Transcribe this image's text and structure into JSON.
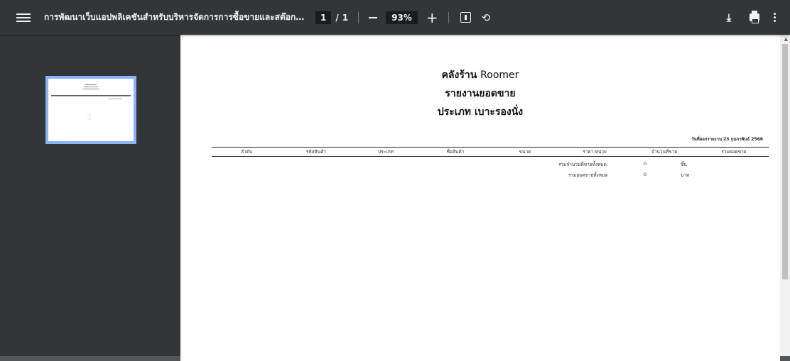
{
  "toolbar": {
    "doc_title": "การพัฒนาเว็บแอปพลิเคชันสำหรับบริหารจัดการการซื้อขายและสต๊อกสินค้า ร้า...",
    "page_current": "1",
    "page_separator": "/",
    "page_total": "1",
    "zoom": "93%",
    "zoom_in_symbol": "+",
    "rotate_symbol": "⟲",
    "download_symbol": "⤓",
    "icons": [
      "menu-icon",
      "fit-page-icon",
      "rotate-icon",
      "download-icon",
      "print-icon",
      "more-vert-icon"
    ]
  },
  "sidebar": {
    "thumbnail_label": "1"
  },
  "report": {
    "title_prefix": "คลังร้าน",
    "title_name": "Roomer",
    "subtitle": "รายงานยอดขาย",
    "category_line": "ประเภท เบาะรองนั่ง",
    "date": "วันที่ออกรายงาน 23 กุมภาพันธ์ 2566",
    "columns": [
      "ลำดับ",
      "รหัสสินค้า",
      "ประเภท",
      "ชื่อสินค้า",
      "ขนาด",
      "ราคา:หน่วย",
      "จำนวนที่ขาย",
      "รวมยอดขาย"
    ],
    "summary": [
      {
        "label": "รวมจำนวนที่ขายทั้งหมด",
        "value": "0",
        "unit": "ชิ้น"
      },
      {
        "label": "รวมยอดขายทั้งหมด",
        "value": "0",
        "unit": "บาท"
      }
    ]
  },
  "colors": {
    "toolbar_bg": "#323639",
    "viewer_bg": "#525659",
    "thumb_selected": "#8ab4f8"
  }
}
